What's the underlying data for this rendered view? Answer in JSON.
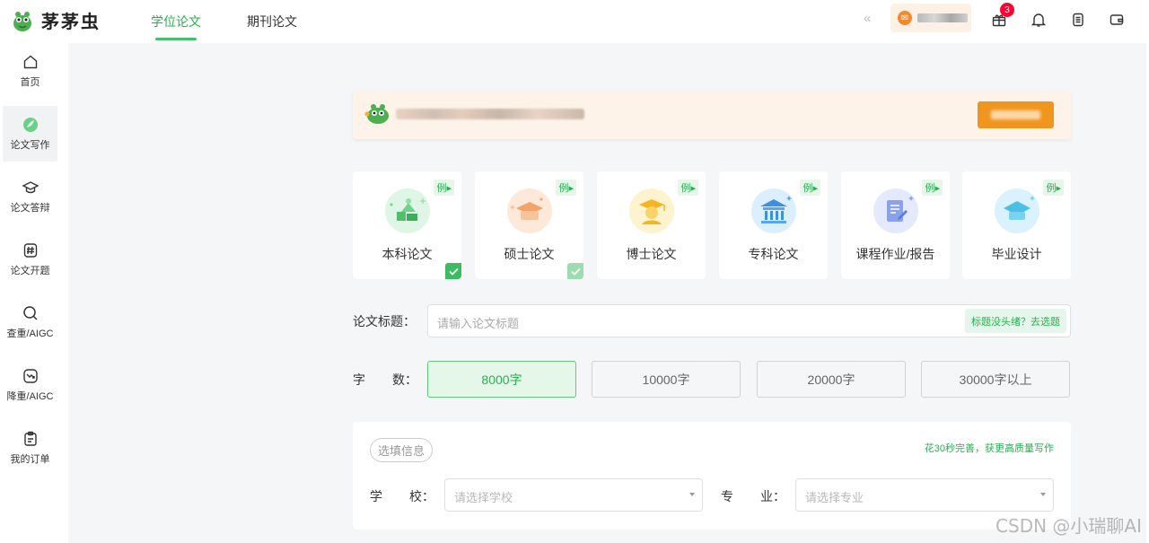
{
  "app": {
    "name": "茅茅虫"
  },
  "nav": {
    "tabs": [
      {
        "label": "学位论文",
        "active": true
      },
      {
        "label": "期刊论文",
        "active": false
      }
    ]
  },
  "header": {
    "collapse_glyph": "«",
    "notification_count": "3"
  },
  "sidebar": {
    "items": [
      {
        "label": "首页",
        "icon": "home-icon"
      },
      {
        "label": "论文写作",
        "icon": "leaf-icon",
        "active": true
      },
      {
        "label": "论文答辩",
        "icon": "graduation-cap-icon"
      },
      {
        "label": "论文开题",
        "icon": "hash-doc-icon"
      },
      {
        "label": "查重/AIGC",
        "icon": "search-icon"
      },
      {
        "label": "降重/AIGC",
        "icon": "trend-down-icon"
      },
      {
        "label": "我的订单",
        "icon": "clipboard-icon"
      }
    ]
  },
  "paper_types": [
    {
      "label": "本科论文",
      "example": "例",
      "checked": true
    },
    {
      "label": "硕士论文",
      "example": "例",
      "checked": true
    },
    {
      "label": "博士论文",
      "example": "例",
      "checked": false
    },
    {
      "label": "专科论文",
      "example": "例",
      "checked": false
    },
    {
      "label": "课程作业/报告",
      "example": "例",
      "checked": false
    },
    {
      "label": "毕业设计",
      "example": "例",
      "checked": false
    }
  ],
  "form": {
    "title_label": "论文标题：",
    "title_placeholder": "请输入论文标题",
    "title_hint": "标题没头绪？去选题",
    "wordcount_label_a": "字",
    "wordcount_label_b": "数：",
    "wordcount_options": [
      "8000字",
      "10000字",
      "20000字",
      "30000字以上"
    ],
    "wordcount_selected": "8000字"
  },
  "optional": {
    "tag": "选填信息",
    "hint": "花30秒完善，获更高质量写作",
    "school_label_a": "学",
    "school_label_b": "校：",
    "school_placeholder": "请选择学校",
    "major_label_a": "专",
    "major_label_b": "业：",
    "major_placeholder": "请选择专业"
  },
  "watermark": "CSDN @小瑞聊AI",
  "colors": {
    "accent": "#27b14e",
    "accent_light": "#e4f7e9",
    "notice_bg": "#fdf3e8",
    "notice_button": "#f0961e",
    "badge": "#ff0033"
  }
}
